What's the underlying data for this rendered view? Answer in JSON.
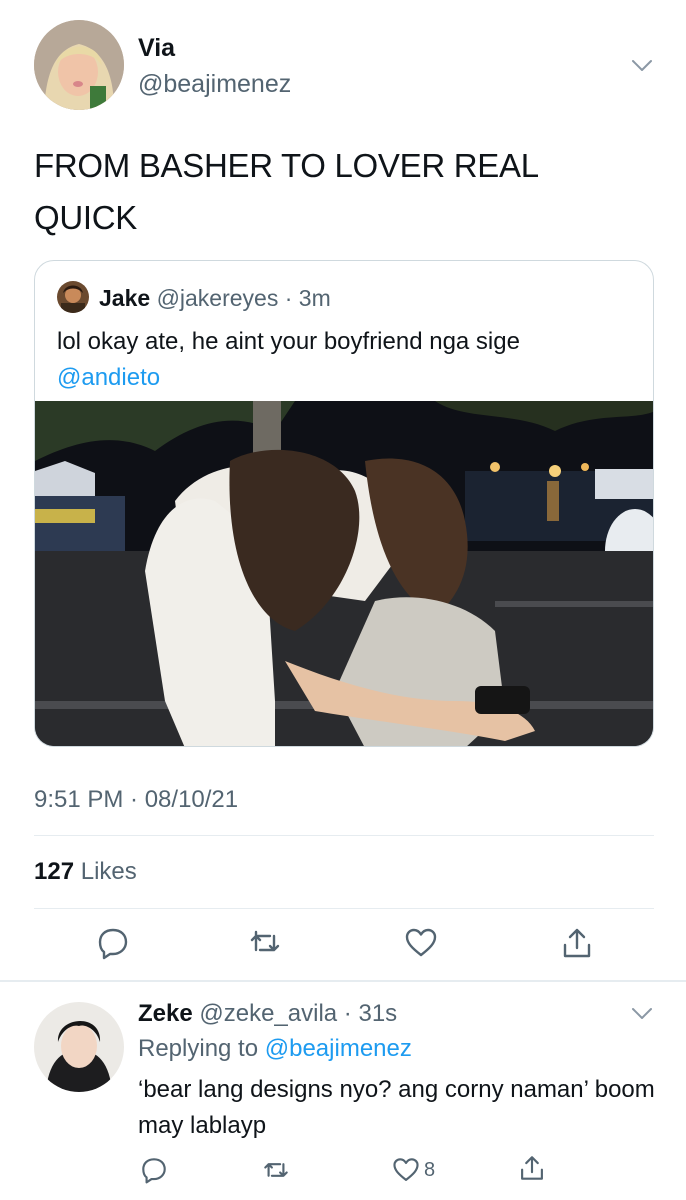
{
  "tweet": {
    "author_name": "Via",
    "author_handle": "@beajimenez",
    "text": "FROM BASHER TO LOVER REAL QUICK",
    "timestamp": "9:51 PM · 08/10/21",
    "likes_count": "127",
    "likes_label": "Likes"
  },
  "quoted": {
    "author_name": "Jake",
    "meta": "@jakereyes · 3m",
    "text": "lol okay ate, he aint your boyfriend nga sige",
    "mention": "@andieto"
  },
  "reply": {
    "author_name": "Zeke",
    "meta": "@zeke_avila · 31s",
    "replying_prefix": "Replying to",
    "replying_to": "@beajimenez",
    "text": "‘bear lang designs nyo? ang corny naman’ boom may lablayp",
    "like_count": "8"
  },
  "icons": {
    "reply": "reply-icon",
    "retweet": "retweet-icon",
    "like": "heart-icon",
    "share": "share-icon",
    "more": "chevron-down-icon"
  },
  "colors": {
    "text": "#0f1419",
    "secondary": "#536471",
    "link": "#1d9bf0",
    "border": "#cfd9de"
  }
}
